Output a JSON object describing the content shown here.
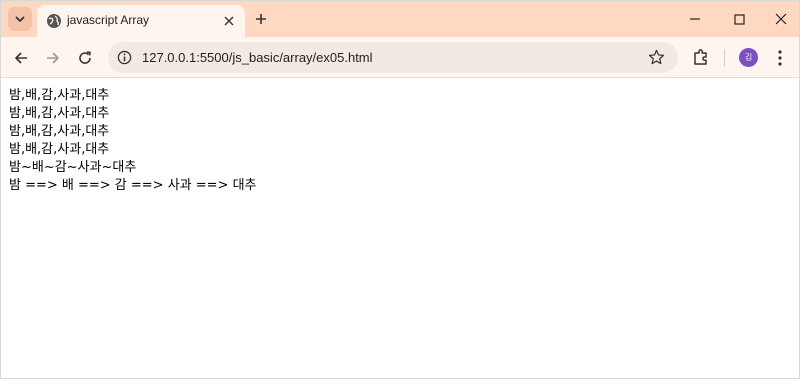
{
  "tab": {
    "title": "javascript Array"
  },
  "address_bar": {
    "url": "127.0.0.1:5500/js_basic/array/ex05.html"
  },
  "profile": {
    "initial": "김"
  },
  "content": {
    "lines": [
      "밤,배,감,사과,대추",
      "밤,배,감,사과,대추",
      "밤,배,감,사과,대추",
      "밤,배,감,사과,대추",
      "밤~배~감~사과~대추",
      "밤 ==> 배 ==> 감 ==> 사과 ==> 대추"
    ]
  },
  "icons": {
    "tab_search": "chevron-down-icon",
    "favicon": "globe-icon",
    "tab_close": "close-icon",
    "new_tab": "plus-icon",
    "minimize": "minimize-icon",
    "maximize": "maximize-icon",
    "close": "close-icon",
    "back": "arrow-left-icon",
    "forward": "arrow-right-icon",
    "reload": "reload-icon",
    "site_info": "info-icon",
    "bookmark": "star-icon",
    "extensions": "puzzle-icon",
    "menu": "kebab-menu-icon"
  },
  "colors": {
    "tabstrip": "#ffd8c2",
    "toolbar": "#fff5ef",
    "avatar": "#7c4fc4"
  }
}
